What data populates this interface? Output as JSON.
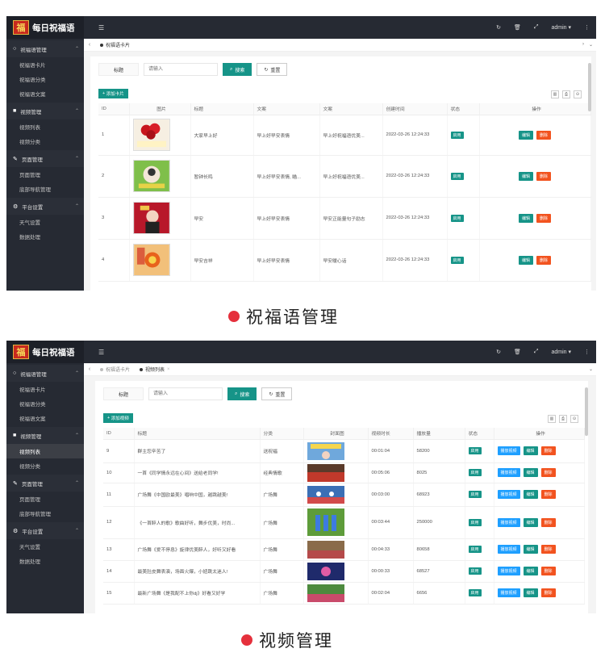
{
  "app": {
    "logo_char": "福",
    "name": "每日祝福语",
    "admin": "admin"
  },
  "sidebar1": {
    "groups": [
      {
        "title": "祝福语管理",
        "icon": "circle-icon",
        "items": [
          "祝福语卡片",
          "祝福语分类",
          "祝福语文案"
        ]
      },
      {
        "title": "视频管理",
        "icon": "video-icon",
        "items": [
          "视频列表",
          "视频分类"
        ]
      },
      {
        "title": "页面管理",
        "icon": "wrench-icon",
        "items": [
          "页面管理",
          "底部导航管理"
        ]
      },
      {
        "title": "平台设置",
        "icon": "gear-icon",
        "items": [
          "天气设置",
          "数据处理"
        ]
      }
    ]
  },
  "screen1": {
    "tabs": [
      "祝福语卡片"
    ],
    "search": {
      "label": "标题",
      "placeholder": "请输入",
      "search_btn": "搜索",
      "reset_btn": "重置"
    },
    "add_btn": "添加卡片",
    "columns": [
      "ID",
      "图片",
      "标题",
      "文案",
      "文案",
      "创建时间",
      "状态",
      "操作"
    ],
    "rows": [
      {
        "id": "1",
        "title": "大家早上好",
        "copy1": "早上好早安表情",
        "copy2": "早上好祝福语优美...",
        "time": "2022-03-26 12:24:33",
        "status": "启用",
        "img": "大家早上好"
      },
      {
        "id": "2",
        "title": "暂钟长鸣",
        "copy1": "早上好早安表情, 瞄...",
        "copy2": "早上好祝福语优美...",
        "time": "2022-03-26 12:24:33",
        "status": "启用",
        "img": "早上好"
      },
      {
        "id": "3",
        "title": "早安",
        "copy1": "早上好早安表情",
        "copy2": "早安正能量句子励志",
        "time": "2022-03-26 12:24:33",
        "status": "启用",
        "img": "早安"
      },
      {
        "id": "4",
        "title": "早安吉祥",
        "copy1": "早上好早安表情",
        "copy2": "早安暖心话",
        "time": "2022-03-26 12:24:33",
        "status": "启用",
        "img": "早安吉祥"
      }
    ],
    "edit_btn": "编辑",
    "delete_btn": "删除",
    "caption": "祝福语管理"
  },
  "screen2": {
    "tabs": [
      "祝福语卡片",
      "视频列表"
    ],
    "search": {
      "label": "标题",
      "placeholder": "请输入",
      "search_btn": "搜索",
      "reset_btn": "重置"
    },
    "add_btn": "添加视频",
    "columns": [
      "ID",
      "标题",
      "分类",
      "封面图",
      "视频时长",
      "播放量",
      "状态",
      "操作"
    ],
    "rows": [
      {
        "id": "9",
        "title": "群主您辛苦了",
        "cat": "送祝福",
        "dur": "00:01:04",
        "plays": "58200",
        "status": "启用",
        "thumb": "群主辛苦了"
      },
      {
        "id": "10",
        "title": "一首《同学情永远在心间》送给老同学!",
        "cat": "经典情歌",
        "dur": "00:05:06",
        "plays": "8025",
        "status": "启用",
        "thumb": ""
      },
      {
        "id": "11",
        "title": "广场舞《中国欧最美》唱响中国，越跳越美!",
        "cat": "广场舞",
        "dur": "00:03:00",
        "plays": "68923",
        "status": "启用",
        "thumb": ""
      },
      {
        "id": "12",
        "title": "《一首醉人的歌》歌曲好听，舞步优美，时尚...",
        "cat": "广场舞",
        "dur": "00:03:44",
        "plays": "250000",
        "status": "启用",
        "thumb": ""
      },
      {
        "id": "13",
        "title": "广场舞《爱不停息》旋律优美醉人，好听又好看",
        "cat": "广场舞",
        "dur": "00:04:33",
        "plays": "80658",
        "status": "启用",
        "thumb": ""
      },
      {
        "id": "14",
        "title": "最美肚皮舞表演，场面火爆，小妞跳太迷人!",
        "cat": "广场舞",
        "dur": "00:00:33",
        "plays": "68527",
        "status": "启用",
        "thumb": ""
      },
      {
        "id": "15",
        "title": "最新广场舞《是我配不上你dj》好看又好学",
        "cat": "广场舞",
        "dur": "00:02:04",
        "plays": "6656",
        "status": "启用",
        "thumb": ""
      }
    ],
    "play_btn": "播放视频",
    "edit_btn": "编辑",
    "delete_btn": "删除",
    "caption": "视频管理"
  },
  "colors": {
    "accent": "#169488",
    "danger": "#f2531f",
    "primary": "#1e9fff",
    "sidebar": "#262a33",
    "caption_dot": "#e5303c"
  }
}
